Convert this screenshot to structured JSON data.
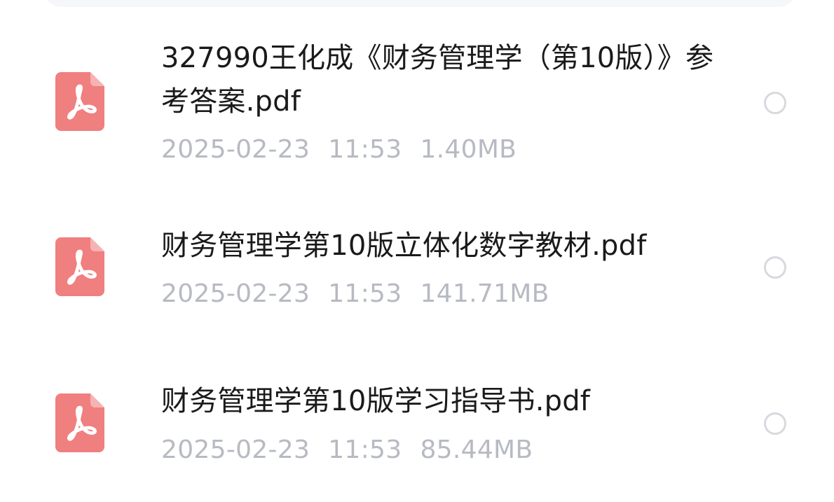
{
  "file_list": {
    "items": [
      {
        "name": "327990王化成《财务管理学（第10版）》参考答案.pdf",
        "date": "2025-02-23",
        "time": "11:53",
        "size": "1.40MB",
        "icon": "pdf-file-icon",
        "selected": false
      },
      {
        "name": "财务管理学第10版立体化数字教材.pdf",
        "date": "2025-02-23",
        "time": "11:53",
        "size": "141.71MB",
        "icon": "pdf-file-icon",
        "selected": false
      },
      {
        "name": "财务管理学第10版学习指导书.pdf",
        "date": "2025-02-23",
        "time": "11:53",
        "size": "85.44MB",
        "icon": "pdf-file-icon",
        "selected": false
      }
    ]
  },
  "colors": {
    "pdf_icon": "#f07f7f",
    "name_text": "#1a1a1a",
    "meta_text": "#b7bac2",
    "radio_border": "#d7d9de",
    "top_bar": "#f6f7fb"
  }
}
